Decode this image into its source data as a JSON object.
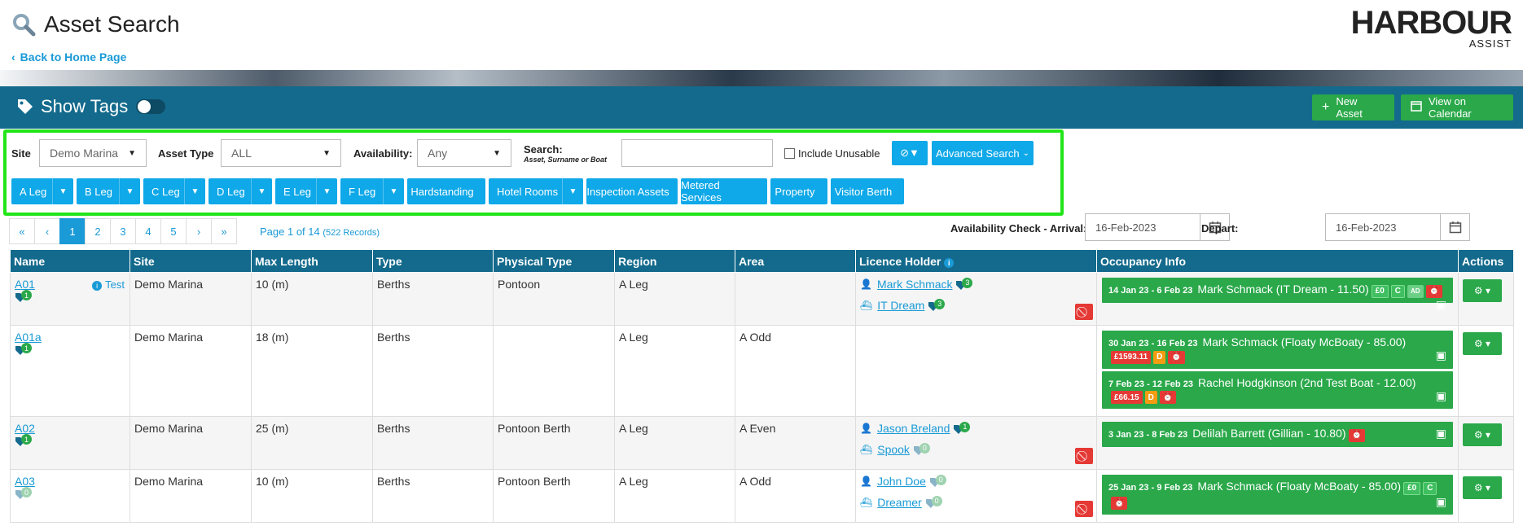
{
  "header": {
    "title": "Asset Search",
    "back_link": "Back to Home Page",
    "logo_main": "HARBOUR",
    "logo_sub": "ASSIST"
  },
  "toolbar": {
    "show_tags": "Show Tags",
    "new_asset": "New Asset",
    "view_calendar": "View on Calendar"
  },
  "filters": {
    "site_label": "Site",
    "site_value": "Demo Marina",
    "asset_type_label": "Asset Type",
    "asset_type_value": "ALL",
    "availability_label": "Availability:",
    "availability_value": "Any",
    "search_label": "Search:",
    "search_hint": "Asset, Surname or Boat",
    "search_value": "",
    "include_unusable": "Include Unusable",
    "advanced_search": "Advanced Search",
    "legs": [
      {
        "label": "A Leg",
        "dropdown": true
      },
      {
        "label": "B Leg",
        "dropdown": true
      },
      {
        "label": "C Leg",
        "dropdown": true
      },
      {
        "label": "D Leg",
        "dropdown": true
      },
      {
        "label": "E Leg",
        "dropdown": true
      },
      {
        "label": "F Leg",
        "dropdown": true
      },
      {
        "label": "Hardstanding",
        "dropdown": false
      },
      {
        "label": "Hotel Rooms",
        "dropdown": true
      },
      {
        "label": "Inspection Assets",
        "dropdown": false
      },
      {
        "label": "Metered Services",
        "dropdown": false
      },
      {
        "label": "Property",
        "dropdown": false
      },
      {
        "label": "Visitor Berth",
        "dropdown": false
      }
    ]
  },
  "pagination": {
    "first": "«",
    "prev": "‹",
    "pages": [
      "1",
      "2",
      "3",
      "4",
      "5"
    ],
    "next": "›",
    "last": "»",
    "info": "Page 1 of 14",
    "records": "(522 Records)"
  },
  "availability": {
    "arrival_label": "Availability Check - Arrival:",
    "arrival_value": "16-Feb-2023",
    "depart_label": "Depart:",
    "depart_value": "16-Feb-2023"
  },
  "table": {
    "columns": [
      "Name",
      "Site",
      "Max Length",
      "Type",
      "Physical Type",
      "Region",
      "Area",
      "Licence Holder",
      "Occupancy Info",
      "Actions"
    ],
    "rows": [
      {
        "name": "A01",
        "tag_count": "1",
        "note": "Test",
        "site": "Demo Marina",
        "max_length": "10 (m)",
        "type": "Berths",
        "physical_type": "Pontoon",
        "region": "A Leg",
        "area": "",
        "holder": "Mark Schmack",
        "holder_tags": "3",
        "boat": "IT Dream",
        "boat_tags": "3",
        "occ": [
          {
            "dates": "14 Jan 23 - 6 Feb 23",
            "text": "Mark Schmack (IT Dream - 11.50)",
            "chips": [
              "£0",
              "C",
              "AD"
            ]
          }
        ]
      },
      {
        "name": "A01a",
        "tag_count": "1",
        "site": "Demo Marina",
        "max_length": "18 (m)",
        "type": "Berths",
        "physical_type": "",
        "region": "A Leg",
        "area": "A Odd",
        "occ": [
          {
            "dates": "30 Jan 23 - 16 Feb 23",
            "text": "Mark Schmack (Floaty McBoaty - 85.00)",
            "chips": [
              "£1593.11",
              "D"
            ]
          },
          {
            "dates": "7 Feb 23 - 12 Feb 23",
            "text": "Rachel Hodgkinson (2nd Test Boat - 12.00)",
            "chips": [
              "£66.15",
              "D"
            ]
          }
        ]
      },
      {
        "name": "A02",
        "tag_count": "1",
        "site": "Demo Marina",
        "max_length": "25 (m)",
        "type": "Berths",
        "physical_type": "Pontoon Berth",
        "region": "A Leg",
        "area": "A Even",
        "holder": "Jason Breland",
        "holder_tags": "1",
        "boat": "Spook",
        "boat_tags": "0",
        "occ": [
          {
            "dates": "3 Jan 23 - 8 Feb 23",
            "text": "Delilah Barrett (Gillian - 10.80)",
            "chips": []
          }
        ]
      },
      {
        "name": "A03",
        "tag_count": "0",
        "site": "Demo Marina",
        "max_length": "10 (m)",
        "type": "Berths",
        "physical_type": "Pontoon Berth",
        "region": "A Leg",
        "area": "A Odd",
        "holder": "John Doe",
        "holder_tags": "0",
        "boat": "Dreamer",
        "boat_tags": "0",
        "occ": [
          {
            "dates": "25 Jan 23 - 9 Feb 23",
            "text": "Mark Schmack (Floaty McBoaty - 85.00)",
            "chips": [
              "£0",
              "C"
            ]
          }
        ]
      }
    ]
  },
  "colors": {
    "toolbar_bg": "#136a8c",
    "accent_blue": "#0fa8e8",
    "green": "#2aa84a",
    "red": "#e53935",
    "highlight": "#22e51a"
  }
}
